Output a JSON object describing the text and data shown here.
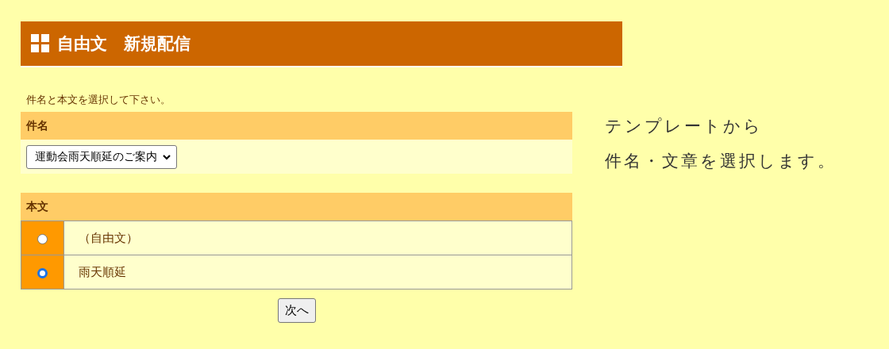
{
  "header": {
    "title": "自由文　新規配信"
  },
  "instruction": "件名と本文を選択して下さい。",
  "subject": {
    "label": "件名",
    "value": "運動会雨天順延のご案内"
  },
  "body": {
    "label": "本文",
    "options": [
      {
        "label": "（自由文）",
        "selected": false
      },
      {
        "label": "雨天順延",
        "selected": true
      }
    ]
  },
  "next_button": "次へ",
  "note": [
    "テンプレートから",
    "件名・文章を選択します。"
  ]
}
